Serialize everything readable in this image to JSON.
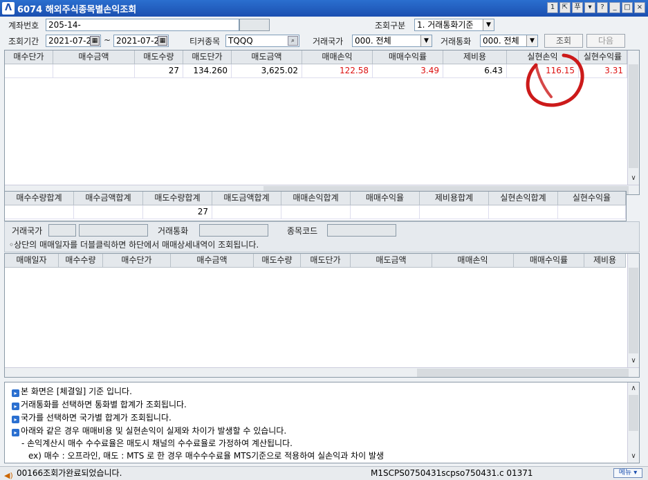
{
  "window": {
    "logo": "Λ",
    "title": "6074 해외주식종목별손익조회",
    "buttons": [
      "1",
      "⇱",
      "푸",
      "▾",
      "?",
      "_",
      "□",
      "×"
    ]
  },
  "form": {
    "account_label": "계좌번호",
    "account_value": "205-14-",
    "query_type_label": "조회구분",
    "query_type_value": "1. 거래통화기준",
    "period_label": "조회기간",
    "start_date": "2021-07-28",
    "tilde": "~",
    "end_date": "2021-07-28",
    "ticker_label": "티커종목",
    "ticker_value": "TQQQ",
    "country_label": "거래국가",
    "country_value": "000. 전체",
    "currency_label": "거래통화",
    "currency_value": "000. 전체",
    "query_button": "조회",
    "next_button": "다음"
  },
  "top_grid": {
    "headers": [
      "매수단가",
      "매수금액",
      "매도수량",
      "매도단가",
      "매도금액",
      "매매손익",
      "매매수익률",
      "제비용",
      "실현손익",
      "실현수익률"
    ],
    "rows": [
      [
        "",
        "",
        "27",
        "134.260",
        "3,625.02",
        "122.58",
        "3.49",
        "6.43",
        "116.15",
        "3.31"
      ]
    ]
  },
  "sum_grid": {
    "headers": [
      "매수수량합계",
      "매수금액합계",
      "매도수량합계",
      "매도금액합계",
      "매매손익합계",
      "매매수익율",
      "제비용합계",
      "실현손익합계",
      "실현수익율"
    ],
    "values": [
      "",
      "",
      "27",
      "",
      "",
      "",
      "",
      "",
      ""
    ]
  },
  "info": {
    "country_label": "거래국가",
    "currency_label": "거래통화",
    "code_label": "종목코드",
    "hint": "◦상단의 매매일자를 더블클릭하면 하단에서 매매상세내역이 조회됩니다."
  },
  "detail_grid": {
    "headers": [
      "매매일자",
      "매수수량",
      "매수단가",
      "매수금액",
      "매도수량",
      "매도단가",
      "매도금액",
      "매매손익",
      "매매수익률",
      "제비용"
    ]
  },
  "notes": [
    "본 화면은 [체결일] 기준 입니다.",
    "거래통화를 선택하면 통화별 합계가 조회됩니다.",
    "국가를 선택하면 국가별 합계가 조회됩니다.",
    "아래와 같은 경우 매매비용 및 실현손익이 실제와 차이가 발생할 수 있습니다.",
    "- 손익계산시 매수 수수료율은 매도시 채널의 수수료율로 가정하여 계산됩니다.",
    "ex) 매수 : 오프라인,  매도 : MTS 로 한 경우  매수수수료율 MTS기준으로 적용하여 실손익과 차이 발생"
  ],
  "status": {
    "message": "00166조회가완료되었습니다.",
    "code": "M1SCPS0750431scpso750431.c    01371",
    "menu": "메뉴 ▾"
  },
  "colors": {
    "title_bar": "#1b4fb0",
    "negative_red": "#d11111",
    "annotation_red": "#cc1a1a"
  }
}
